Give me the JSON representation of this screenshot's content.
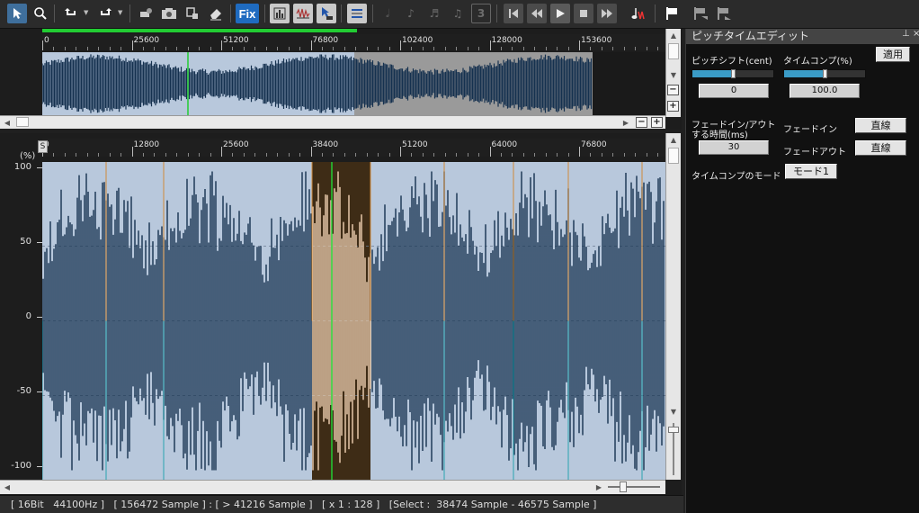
{
  "toolbar": {
    "fix_label": "Fix",
    "counter_label": "3",
    "icons": [
      "cursor-select-icon",
      "zoom-icon",
      "undo-icon",
      "redo-icon",
      "pipette-icon",
      "camera-icon",
      "stamp-icon",
      "eraser-icon",
      "fix-icon",
      "spectrum-icon",
      "waveform-icon",
      "cursor-region-icon",
      "level-icon",
      "note-whole-icon",
      "note-eighth-icon",
      "note-sixteenth-icon",
      "note-thirtysecond-icon",
      "triplet-icon",
      "go-start-icon",
      "rewind-icon",
      "play-icon",
      "stop-icon",
      "fast-forward-icon",
      "metronome-icon",
      "flag-icon",
      "flag-prev-icon",
      "flag-next-icon"
    ]
  },
  "overview": {
    "ruler_labels": [
      "0",
      "25600",
      "51200",
      "76800",
      "102400",
      "128000",
      "153600"
    ],
    "progress_fraction": 0.505
  },
  "main": {
    "ruler_labels": [
      "0",
      "12800",
      "25600",
      "38400",
      "51200",
      "64000",
      "76800"
    ],
    "y_axis_unit": "(%)",
    "y_labels": [
      "100",
      "50",
      "0",
      "-50",
      "-100"
    ],
    "marker_label": "S"
  },
  "status": {
    "text": "[ 16Bit   44100Hz ]   [ 156472 Sample ] : [ > 41216 Sample ]   [ x 1 : 128 ]   [Select :  38474 Sample - 46575 Sample ]"
  },
  "panel": {
    "title": "ピッチタイムエディット",
    "pin_icon_label": "⊥",
    "close_icon_label": "×",
    "pitch_shift_label": "ピッチシフト(cent)",
    "pitch_shift_value": "0",
    "pitch_shift_fraction": 0.5,
    "time_comp_label": "タイムコンプ(%)",
    "time_comp_value": "100.0",
    "time_comp_fraction": 0.5,
    "apply_button": "適用",
    "fade_time_label_1": "フェードイン/アウト",
    "fade_time_label_2": "する時間(ms)",
    "fade_time_value": "30",
    "fade_in_label": "フェードイン",
    "fade_in_button": "直線",
    "fade_out_label": "フェードアウト",
    "fade_out_button": "直線",
    "time_comp_mode_label": "タイムコンプのモード",
    "mode_button": "モード1"
  },
  "colors": {
    "waveform": "#15314f",
    "waveform_bg": "#b8c8dc",
    "selection_bg": "#3e2c16",
    "selection_wave": "#f2d3b4",
    "cursor": "#22cc33",
    "marker_orange": "#d08a3a",
    "marker_teal": "#2aa5b0",
    "overview_progress": "#22cc33",
    "slider_fill": "#3a9bc6"
  }
}
